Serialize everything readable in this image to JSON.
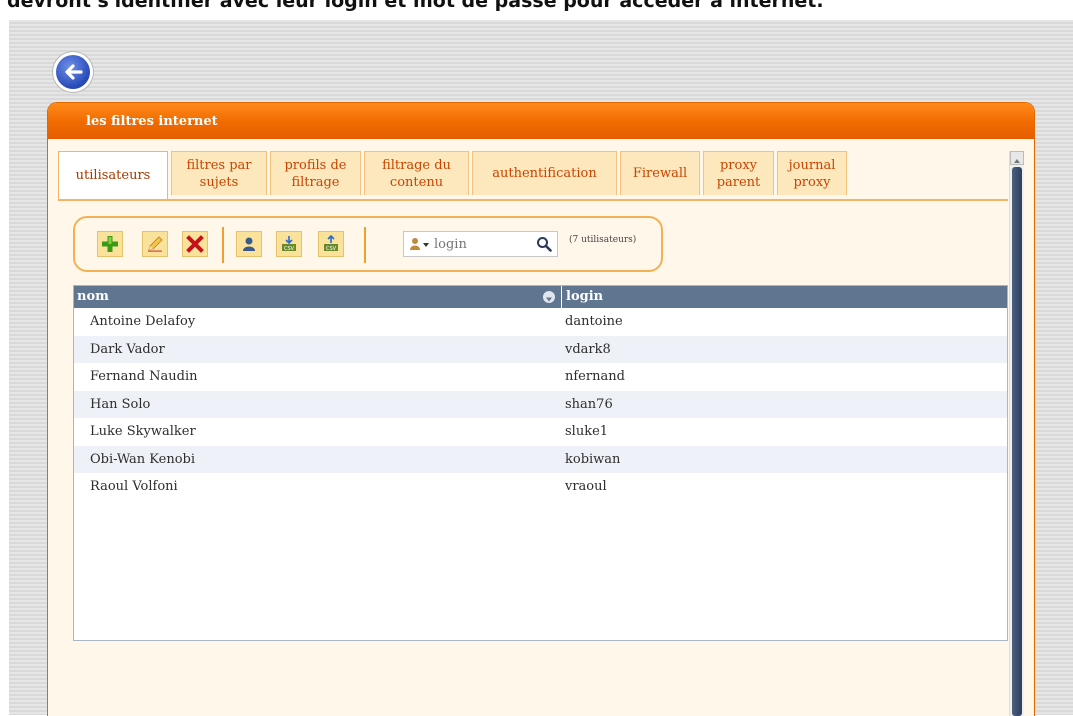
{
  "caption": "devront s'identifier avec leur login et mot de passe pour accéder à internet.",
  "window": {
    "title": "les filtres internet"
  },
  "tabs": [
    {
      "label": "utilisateurs",
      "active": true
    },
    {
      "label": "filtres par sujets",
      "active": false
    },
    {
      "label": "profils de filtrage",
      "active": false
    },
    {
      "label": "filtrage du contenu",
      "active": false
    },
    {
      "label": "authentification",
      "active": false
    },
    {
      "label": "Firewall",
      "active": false
    },
    {
      "label": "proxy parent",
      "active": false
    },
    {
      "label": "journal proxy",
      "active": false
    }
  ],
  "toolbar": {
    "icons": [
      "add-icon",
      "edit-icon",
      "delete-icon",
      "user-icon",
      "csv-import-icon",
      "csv-export-icon"
    ],
    "search": {
      "filter_icon": "user-filter-icon",
      "placeholder": "login",
      "search_icon": "magnifier-icon"
    },
    "count_text": "(7 utilisateurs)"
  },
  "table": {
    "columns": [
      "nom",
      "login"
    ],
    "rows": [
      {
        "nom": "Antoine Delafoy",
        "login": "dantoine"
      },
      {
        "nom": "Dark Vador",
        "login": "vdark8"
      },
      {
        "nom": "Fernand Naudin",
        "login": "nfernand"
      },
      {
        "nom": "Han Solo",
        "login": "shan76"
      },
      {
        "nom": "Luke Skywalker",
        "login": "sluke1"
      },
      {
        "nom": "Obi-Wan Kenobi",
        "login": "kobiwan"
      },
      {
        "nom": "Raoul Volfoni",
        "login": "vraoul"
      }
    ]
  },
  "colors": {
    "titlebar": "#f06a00",
    "tab_text": "#c94400",
    "tab_bg": "#fde7bd",
    "table_header": "#5f7590",
    "alt_row": "#eef2f8",
    "back_button": "#2749b8"
  }
}
